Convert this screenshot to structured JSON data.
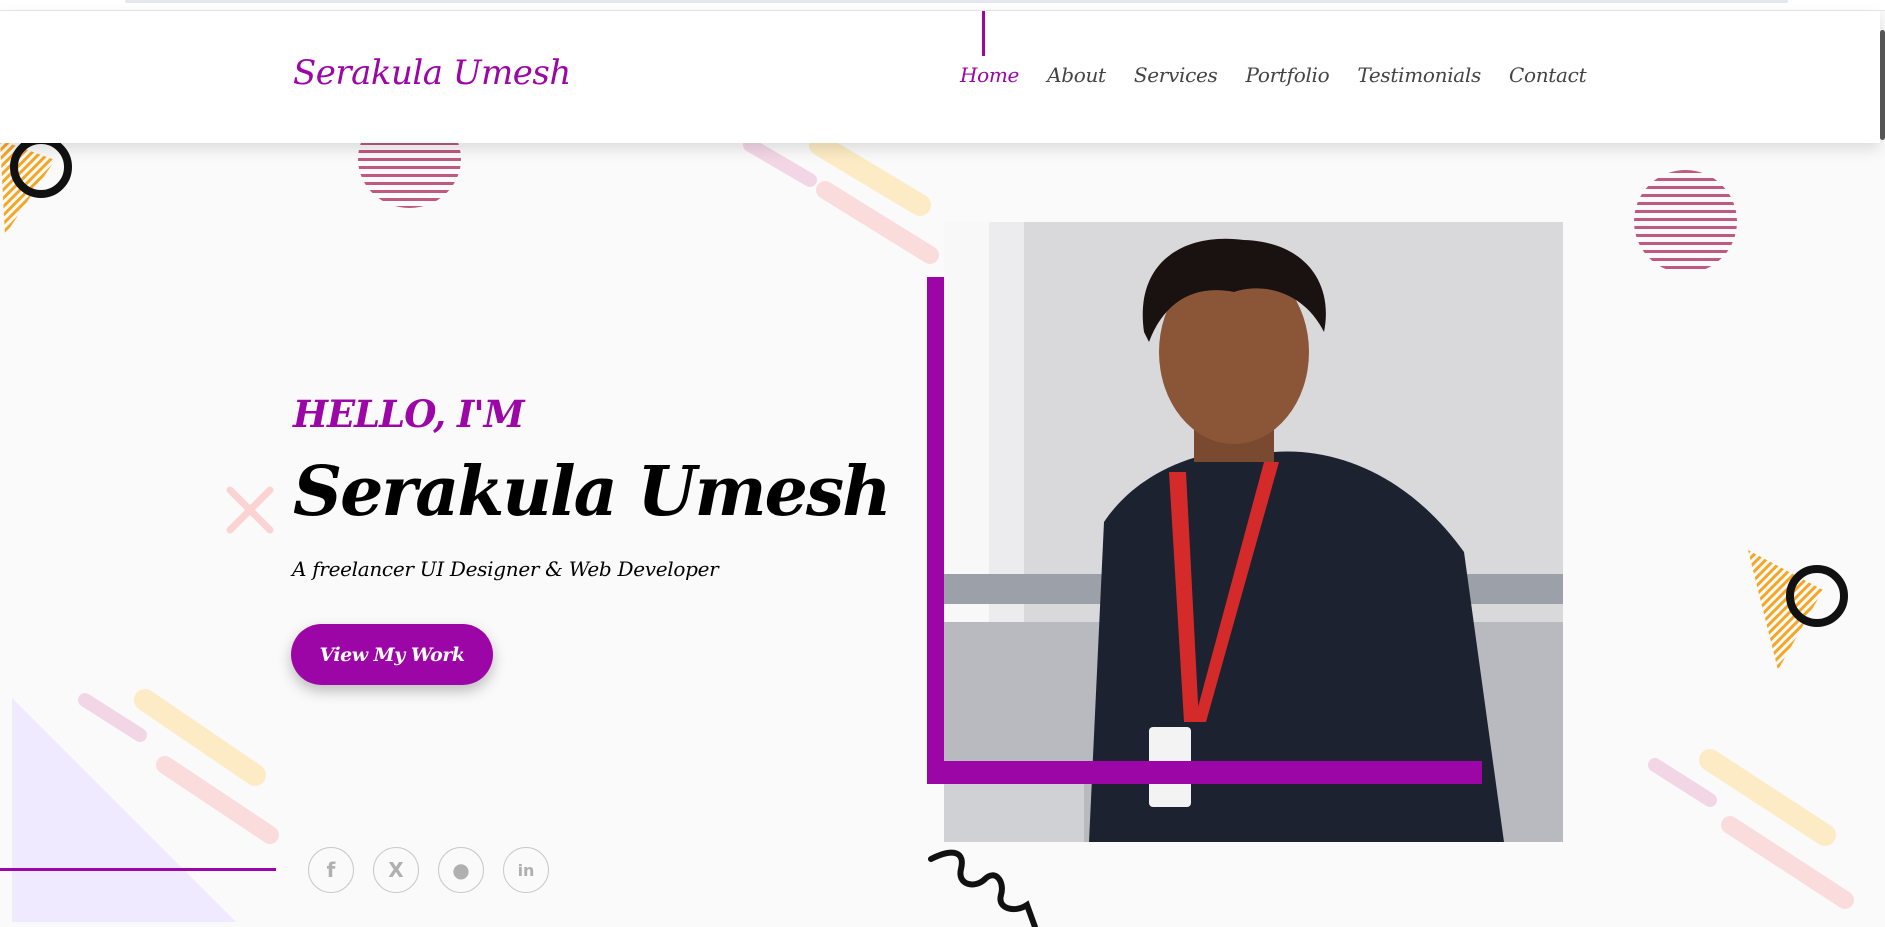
{
  "header": {
    "logo": "Serakula Umesh",
    "nav": [
      {
        "label": "Home",
        "active": true
      },
      {
        "label": "About",
        "active": false
      },
      {
        "label": "Services",
        "active": false
      },
      {
        "label": "Portfolio",
        "active": false
      },
      {
        "label": "Testimonials",
        "active": false
      },
      {
        "label": "Contact",
        "active": false
      }
    ]
  },
  "hero": {
    "greeting": "HELLO, I'M",
    "name": "Serakula Umesh",
    "tagline": "A freelancer UI Designer & Web Developer",
    "cta_label": "View My Work",
    "photo_alt": "Serakula Umesh"
  },
  "social": [
    {
      "icon": "facebook-icon",
      "glyph": "f"
    },
    {
      "icon": "x-icon",
      "glyph": "X"
    },
    {
      "icon": "github-icon",
      "glyph": "●"
    },
    {
      "icon": "linkedin-icon",
      "glyph": "in"
    }
  ],
  "colors": {
    "accent": "#9c05a6",
    "text": "#000000",
    "nav_text": "#444444",
    "background": "#fafafa"
  }
}
